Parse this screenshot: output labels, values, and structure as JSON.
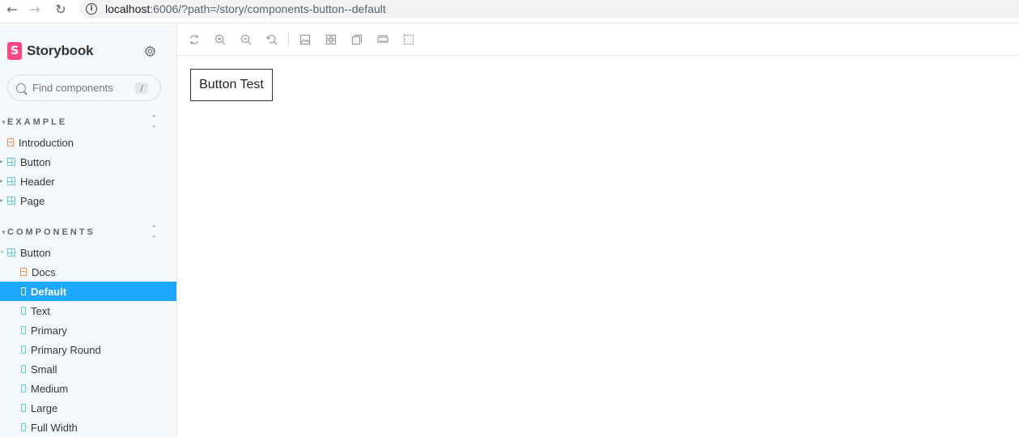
{
  "browser": {
    "url_host": "localhost",
    "url_rest": ":6006/?path=/story/components-button--default",
    "back_icon": "←",
    "forward_icon": "→",
    "reload_icon": "↻",
    "info_icon": "i"
  },
  "sidebar": {
    "brand": "Storybook",
    "brand_logo": "S",
    "search_placeholder": "Find components",
    "search_shortcut": "/",
    "groups": [
      {
        "label": "EXAMPLE",
        "items": [
          {
            "label": "Introduction",
            "icon": "document-icon"
          },
          {
            "label": "Button",
            "icon": "component-icon"
          },
          {
            "label": "Header",
            "icon": "component-icon"
          },
          {
            "label": "Page",
            "icon": "component-icon"
          }
        ]
      },
      {
        "label": "COMPONENTS",
        "items": [
          {
            "label": "Button",
            "icon": "component-icon"
          },
          {
            "label": "Docs",
            "icon": "document-icon"
          },
          {
            "label": "Default",
            "icon": "story-icon",
            "selected": true
          },
          {
            "label": "Text",
            "icon": "story-icon"
          },
          {
            "label": "Primary",
            "icon": "story-icon"
          },
          {
            "label": "Primary Round",
            "icon": "story-icon"
          },
          {
            "label": "Small",
            "icon": "story-icon"
          },
          {
            "label": "Medium",
            "icon": "story-icon"
          },
          {
            "label": "Large",
            "icon": "story-icon"
          },
          {
            "label": "Full Width",
            "icon": "story-icon"
          }
        ]
      }
    ]
  },
  "toolbar": {
    "tools": [
      "remount-icon",
      "zoom-in-icon",
      "zoom-out-icon",
      "zoom-reset-icon",
      "background-icon",
      "grid-icon",
      "viewport-icon",
      "measure-icon",
      "outline-icon"
    ]
  },
  "canvas": {
    "button_label": "Button Test"
  },
  "colors": {
    "accent": "#1ea7fd",
    "brand": "#ff4785"
  }
}
